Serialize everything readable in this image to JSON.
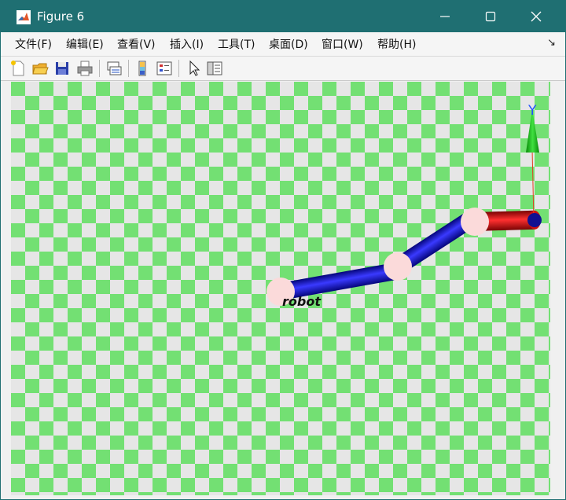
{
  "window": {
    "title": "Figure 6",
    "icon": "matlab-icon",
    "controls": [
      "minimize-icon",
      "maximize-icon",
      "close-icon"
    ]
  },
  "menu": {
    "items": [
      {
        "label": "文件(F)"
      },
      {
        "label": "编辑(E)"
      },
      {
        "label": "查看(V)"
      },
      {
        "label": "插入(I)"
      },
      {
        "label": "工具(T)"
      },
      {
        "label": "桌面(D)"
      },
      {
        "label": "窗口(W)"
      },
      {
        "label": "帮助(H)"
      }
    ],
    "overflow_icon": "dock-arrow-icon"
  },
  "toolbar": {
    "buttons": [
      "new-figure-icon",
      "open-file-icon",
      "save-icon",
      "print-icon",
      "link-plot-icon",
      "colorbar-icon",
      "legend-icon",
      "edit-plot-icon",
      "property-inspector-icon"
    ]
  },
  "scene": {
    "robot_label": "robot",
    "axis_label": "Y",
    "colors": {
      "checker_light": "#e6e6e6",
      "checker_green": "#73e073",
      "link_blue": "#1010c8",
      "tool_red": "#cc1010",
      "joint_pink": "#fbdada",
      "axis_green": "#10b010",
      "axis_label_blue": "#2050ff"
    }
  }
}
